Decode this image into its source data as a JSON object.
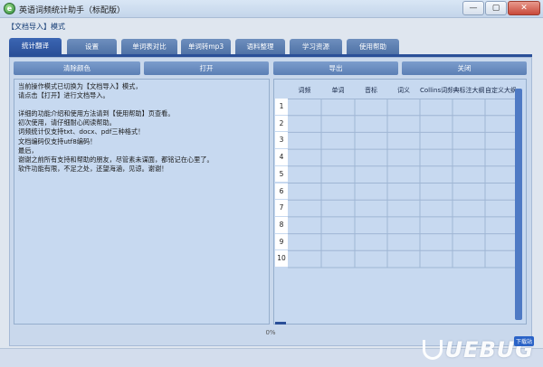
{
  "window": {
    "title": "英语词频统计助手（标配版）",
    "app_icon_letter": "e",
    "buttons": {
      "minimize": "—",
      "restore": "▢",
      "close": "✕"
    }
  },
  "mode_label": "【文档导入】模式",
  "tabs": [
    {
      "label": "统计翻译",
      "active": true
    },
    {
      "label": "设置",
      "active": false
    },
    {
      "label": "单词表对比",
      "active": false
    },
    {
      "label": "单词转mp3",
      "active": false
    },
    {
      "label": "语料整理",
      "active": false
    },
    {
      "label": "学习资源",
      "active": false
    },
    {
      "label": "使用帮助",
      "active": false
    }
  ],
  "actions": {
    "clear_color": "清除颜色",
    "open": "打开",
    "export": "导出",
    "close": "关闭"
  },
  "info_text": [
    "当前操作模式已切换为【文档导入】模式，",
    "请点击【打开】进行文档导入。",
    "",
    "详细的功能介绍和使用方法请到【使用帮助】页查看。",
    "初次使用，请仔细耐心阅读帮助。",
    "词频统计仅支持txt、docx、pdf三种格式！",
    "文档编码仅支持utf8编码！",
    "最后，",
    "谢谢之前所有支持和帮助的朋友，尽管素未谋面，都铭记在心里了。",
    "软件功能有限，不足之处，还望海涵，见谅。谢谢！"
  ],
  "table": {
    "columns": [
      "词频",
      "单词",
      "音标",
      "词义",
      "Collins词频",
      "典标注大纲",
      "自定义大纲"
    ],
    "rows": [
      "1",
      "2",
      "3",
      "4",
      "5",
      "6",
      "7",
      "8",
      "9",
      "10"
    ]
  },
  "progress": {
    "label": "0%",
    "value": 0
  },
  "watermark": {
    "text": "UEBUG",
    "badge": "下载站"
  },
  "colors": {
    "tab_active": "#2a4f98",
    "tab": "#5b7fb5",
    "panel": "#c9d8ec",
    "grid_cell": "#c7d9f0",
    "scrollbar": "#4f7ac4"
  }
}
